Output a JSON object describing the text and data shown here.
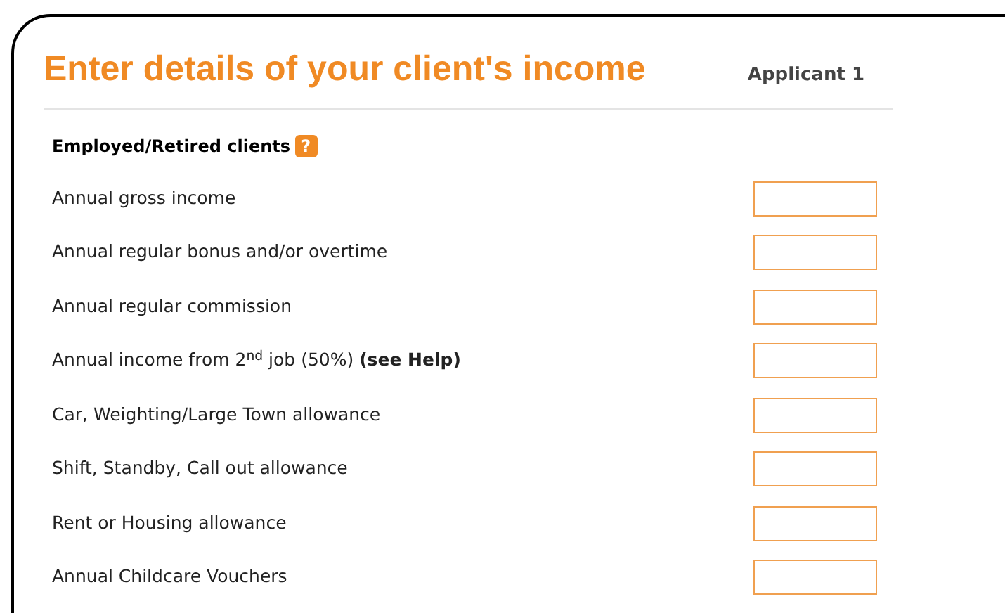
{
  "title": "Enter details of your client's income",
  "column_heading": "Applicant 1",
  "section": {
    "label": "Employed/Retired clients",
    "help": "?"
  },
  "fields": [
    {
      "label": "Annual gross income"
    },
    {
      "label": "Annual regular bonus and/or overtime"
    },
    {
      "label": "Annual regular commission"
    },
    {
      "label": "Annual income from 2$^{nd}$ job (50%) **(see Help)**"
    },
    {
      "label": "Car, Weighting/Large Town allowance"
    },
    {
      "label": "Shift, Standby, Call out allowance"
    },
    {
      "label": "Rent or Housing allowance"
    },
    {
      "label": "Annual Childcare Vouchers"
    }
  ]
}
